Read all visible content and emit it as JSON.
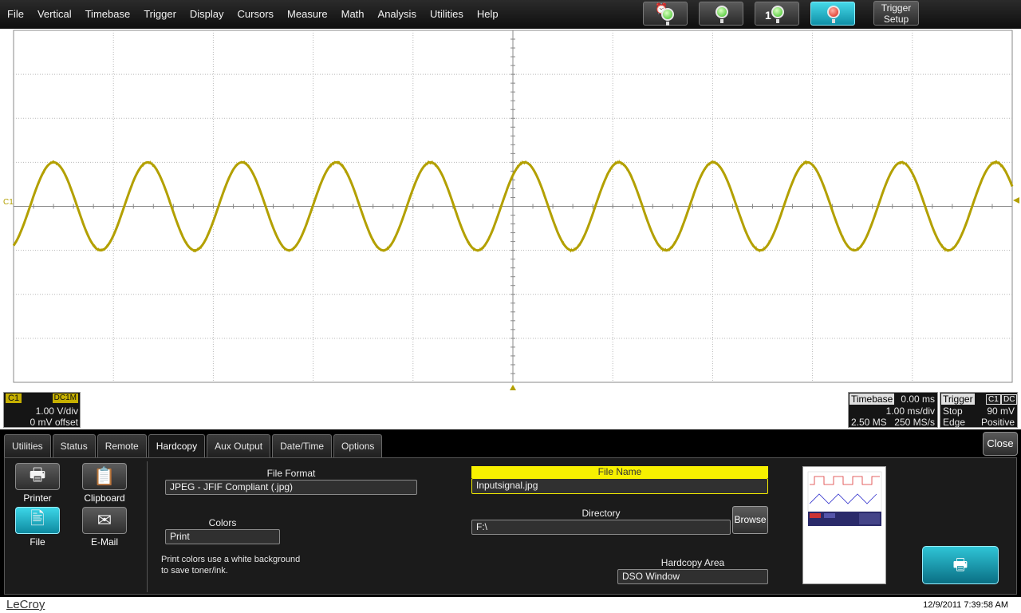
{
  "menu": [
    "File",
    "Vertical",
    "Timebase",
    "Trigger",
    "Display",
    "Cursors",
    "Measure",
    "Math",
    "Analysis",
    "Utilities",
    "Help"
  ],
  "toolbar": {
    "single_badge": "1",
    "trigger_setup": [
      "Trigger",
      "Setup"
    ]
  },
  "channel": {
    "label": "C1",
    "coupling": "DC1M",
    "vdiv": "1.00 V/div",
    "offset": "0 mV offset",
    "color": "#b3a000"
  },
  "timebase": {
    "title": "Timebase",
    "delay": "0.00 ms",
    "tdiv": "1.00 ms/div",
    "samples": "2.50 MS",
    "rate": "250 MS/s"
  },
  "trigger": {
    "title": "Trigger",
    "source": "C1",
    "coupling": "DC",
    "mode": "Stop",
    "level": "90 mV",
    "type": "Edge",
    "slope": "Positive"
  },
  "dialog": {
    "tabs": [
      "Utilities",
      "Status",
      "Remote",
      "Hardcopy",
      "Aux Output",
      "Date/Time",
      "Options"
    ],
    "active_tab": "Hardcopy",
    "close": "Close",
    "destinations": {
      "printer": "Printer",
      "clipboard": "Clipboard",
      "file": "File",
      "email": "E-Mail"
    },
    "file_format_label": "File Format",
    "file_format_value": "JPEG - JFIF Compliant (.jpg)",
    "colors_label": "Colors",
    "colors_value": "Print",
    "colors_note": [
      "Print colors use a white background",
      "to save toner/ink."
    ],
    "file_name_label": "File Name",
    "file_name_value": "Inputsignal.jpg",
    "directory_label": "Directory",
    "directory_value": "F:\\",
    "browse": "Browse",
    "hardcopy_area_label": "Hardcopy Area",
    "hardcopy_area_value": "DSO Window"
  },
  "status": {
    "brand": "LeCroy",
    "datetime": "12/9/2011 7:39:58 AM"
  },
  "waveform": {
    "cycles": 10.6,
    "amplitude_div": 1.0,
    "noise_div": 0.08
  }
}
